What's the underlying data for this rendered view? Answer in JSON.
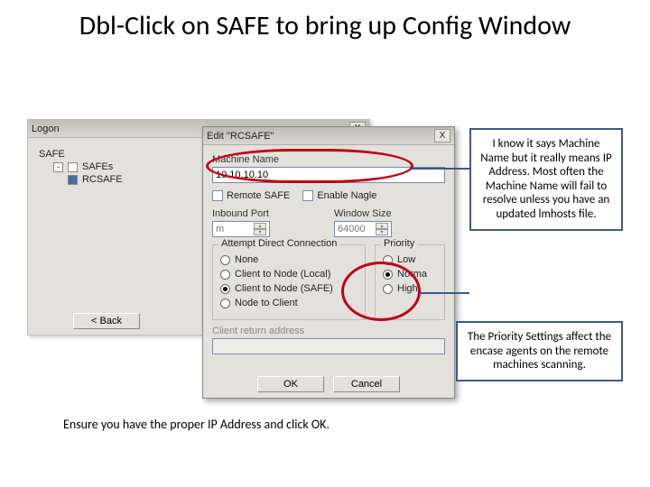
{
  "slide_title": "Dbl-Click on SAFE to bring up Config Window",
  "logon": {
    "title": "Logon",
    "close": "X",
    "tree": {
      "root": "SAFE",
      "group": "SAFEs",
      "item": "RCSAFE"
    },
    "back_btn": "< Back"
  },
  "edit": {
    "title": "Edit \"RCSAFE\"",
    "close": "X",
    "machine_label": "Machine Name",
    "machine_value": "10.10.10.10",
    "remote_safe": "Remote SAFE",
    "enable_nagle": "Enable Nagle",
    "inbound_label": "Inbound Port",
    "inbound_value": "m",
    "winsize_label": "Window Size",
    "winsize_value": "64000",
    "attempt_legend": "Attempt Direct Connection",
    "attempt_options": [
      "None",
      "Client to Node (Local)",
      "Client to Node (SAFE)",
      "Node to Client"
    ],
    "attempt_selected": 2,
    "priority_legend": "Priority",
    "priority_options": [
      "Low",
      "Norma",
      "High"
    ],
    "priority_selected": 1,
    "client_return": "Client return address",
    "ok": "OK",
    "cancel": "Cancel"
  },
  "callouts": {
    "c1": "I know it says Machine Name but it really means IP Address.  Most often the Machine Name will fail to resolve unless you have an updated lmhosts file.",
    "c2": "The Priority Settings affect the encase agents on the remote machines scanning."
  },
  "caption": "Ensure you have the proper IP Address and click OK."
}
